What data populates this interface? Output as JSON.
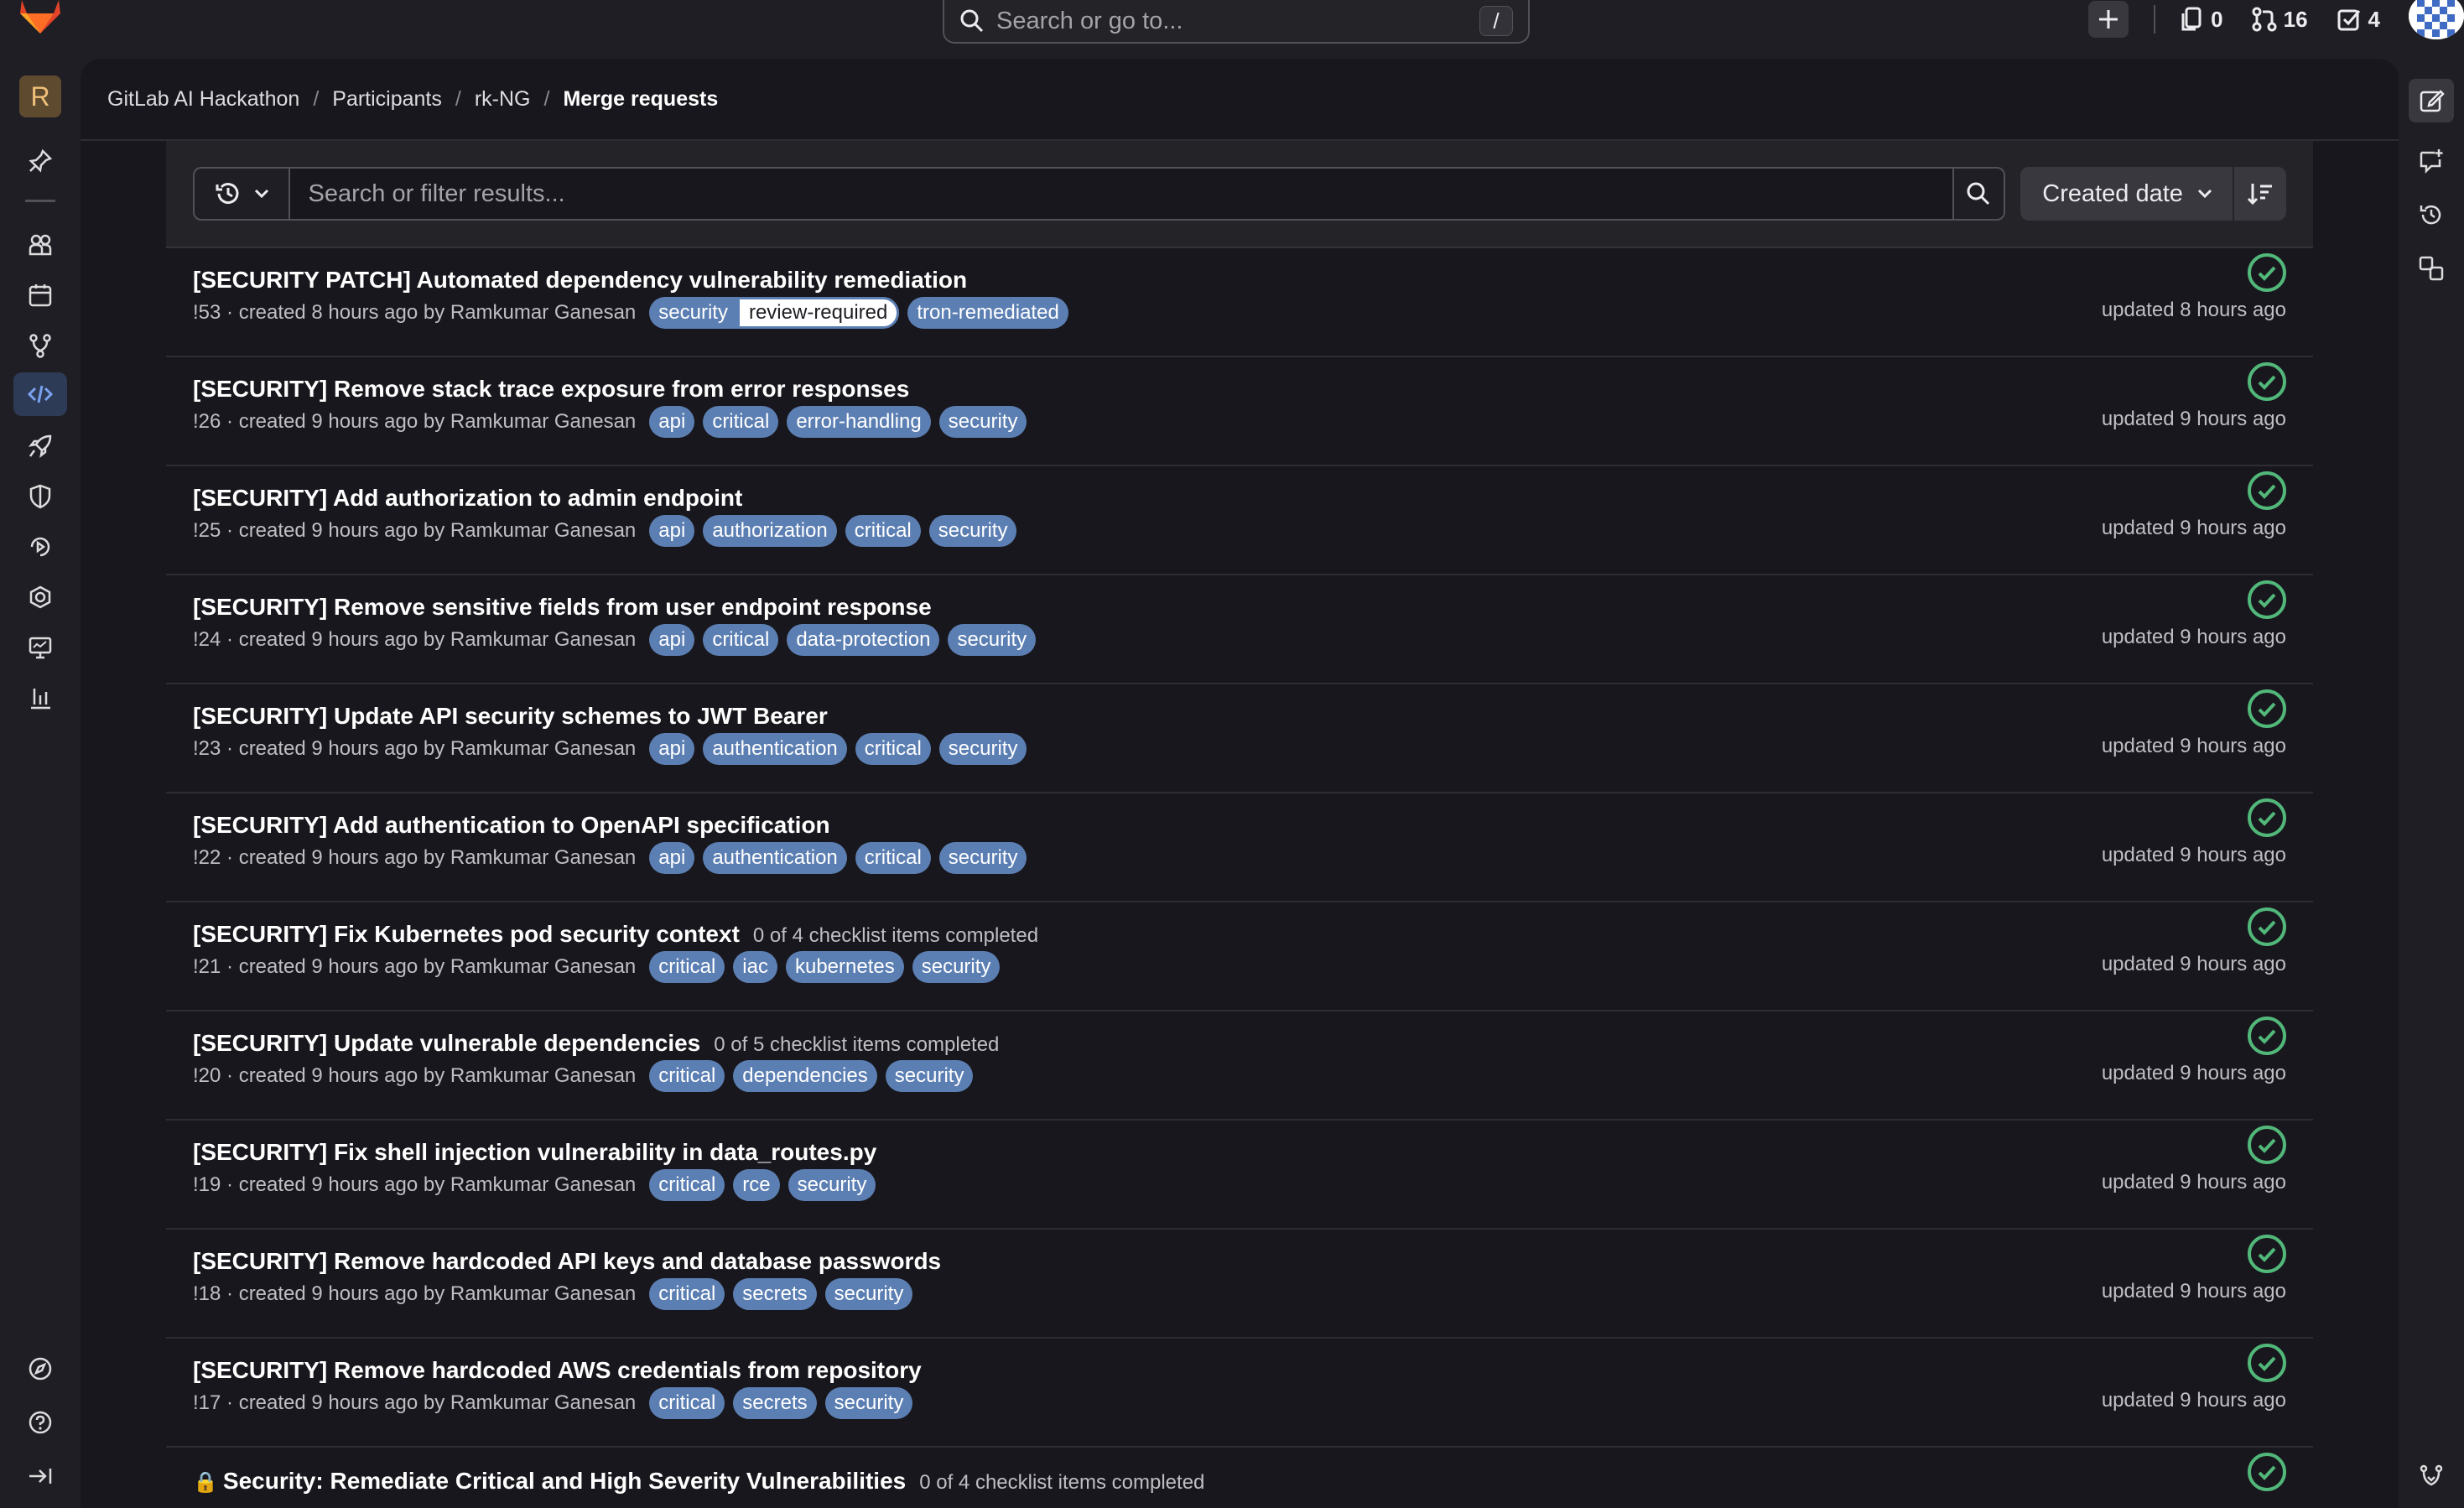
{
  "topbar": {
    "search_placeholder": "Search or go to...",
    "search_shortcut": "/",
    "issues_count": "0",
    "merge_requests_count": "16",
    "todos_count": "4"
  },
  "sidebar": {
    "project_initial": "R"
  },
  "breadcrumb": [
    "GitLab AI Hackathon",
    "Participants",
    "rk-NG",
    "Merge requests"
  ],
  "filter": {
    "placeholder": "Search or filter results...",
    "sort_label": "Created date"
  },
  "merge_requests": [
    {
      "title": "[SECURITY PATCH] Automated dependency vulnerability remediation",
      "checklist": "",
      "meta": "!53 · created 8 hours ago by Ramkumar Ganesan",
      "updated": "updated 8 hours ago"
    },
    {
      "title": "[SECURITY] Remove stack trace exposure from error responses",
      "checklist": "",
      "meta": "!26 · created 9 hours ago by Ramkumar Ganesan",
      "updated": "updated 9 hours ago"
    },
    {
      "title": "[SECURITY] Add authorization to admin endpoint",
      "checklist": "",
      "meta": "!25 · created 9 hours ago by Ramkumar Ganesan",
      "updated": "updated 9 hours ago"
    },
    {
      "title": "[SECURITY] Remove sensitive fields from user endpoint response",
      "checklist": "",
      "meta": "!24 · created 9 hours ago by Ramkumar Ganesan",
      "updated": "updated 9 hours ago"
    },
    {
      "title": "[SECURITY] Update API security schemes to JWT Bearer",
      "checklist": "",
      "meta": "!23 · created 9 hours ago by Ramkumar Ganesan",
      "updated": "updated 9 hours ago"
    },
    {
      "title": "[SECURITY] Add authentication to OpenAPI specification",
      "checklist": "",
      "meta": "!22 · created 9 hours ago by Ramkumar Ganesan",
      "updated": "updated 9 hours ago"
    },
    {
      "title": "[SECURITY] Fix Kubernetes pod security context",
      "checklist": "0 of 4 checklist items completed",
      "meta": "!21 · created 9 hours ago by Ramkumar Ganesan",
      "updated": "updated 9 hours ago"
    },
    {
      "title": "[SECURITY] Update vulnerable dependencies",
      "checklist": "0 of 5 checklist items completed",
      "meta": "!20 · created 9 hours ago by Ramkumar Ganesan",
      "updated": "updated 9 hours ago"
    },
    {
      "title": "[SECURITY] Fix shell injection vulnerability in data_routes.py",
      "checklist": "",
      "meta": "!19 · created 9 hours ago by Ramkumar Ganesan",
      "updated": "updated 9 hours ago"
    },
    {
      "title": "[SECURITY] Remove hardcoded API keys and database passwords",
      "checklist": "",
      "meta": "!18 · created 9 hours ago by Ramkumar Ganesan",
      "updated": "updated 9 hours ago"
    },
    {
      "title": "[SECURITY] Remove hardcoded AWS credentials from repository",
      "checklist": "",
      "meta": "!17 · created 9 hours ago by Ramkumar Ganesan",
      "updated": "updated 9 hours ago"
    },
    {
      "title": "Security: Remediate Critical and High Severity Vulnerabilities",
      "checklist": "0 of 4 checklist items completed",
      "meta": "",
      "updated": ""
    }
  ],
  "labels": {
    "r0": [
      "security",
      "review-required",
      "tron-remediated"
    ],
    "r1": [
      "api",
      "critical",
      "error-handling",
      "security"
    ],
    "r2": [
      "api",
      "authorization",
      "critical",
      "security"
    ],
    "r3": [
      "api",
      "critical",
      "data-protection",
      "security"
    ],
    "r4": [
      "api",
      "authentication",
      "critical",
      "security"
    ],
    "r5": [
      "api",
      "authentication",
      "critical",
      "security"
    ],
    "r6": [
      "critical",
      "iac",
      "kubernetes",
      "security"
    ],
    "r7": [
      "critical",
      "dependencies",
      "security"
    ],
    "r8": [
      "critical",
      "rce",
      "security"
    ],
    "r9": [
      "critical",
      "secrets",
      "security"
    ],
    "r10": [
      "critical",
      "secrets",
      "security"
    ]
  },
  "colors": {
    "label_bg": "#5c7fb3",
    "success": "#52b87a",
    "active_nav": "#2e3b57"
  }
}
